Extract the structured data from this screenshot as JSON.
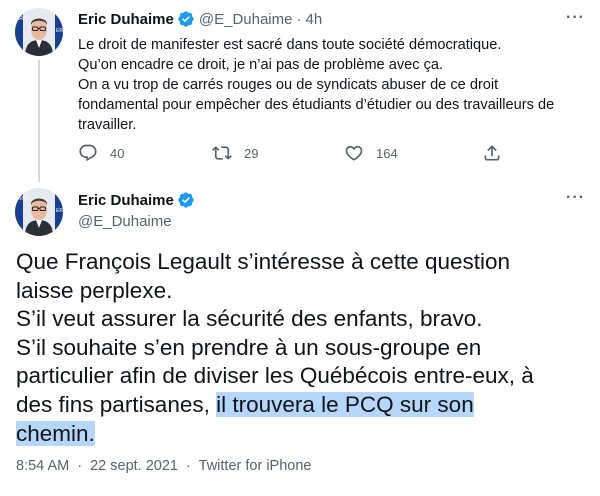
{
  "tweet1": {
    "author_name": "Eric Duhaime",
    "handle": "@E_Duhaime",
    "separator": "·",
    "time": "4h",
    "more": "···",
    "lines": [
      "Le droit de manifester est sacré dans toute société démocratique.",
      "Qu’on encadre ce droit, je n’ai pas de problème avec ça.",
      "On a vu trop de carrés rouges ou de syndicats abuser de ce droit",
      "fondamental pour empêcher des étudiants d’étudier ou des travailleurs de",
      "travailler."
    ],
    "replies": "40",
    "retweets": "29",
    "likes": "164"
  },
  "tweet2": {
    "author_name": "Eric Duhaime",
    "handle": "@E_Duhaime",
    "more": "···",
    "lines": [
      "Que François Legault s’intéresse à cette question",
      "laisse perplexe.",
      "S’il veut assurer la sécurité des enfants, bravo.",
      "S’il souhaite s’en prendre à un sous-groupe en",
      "particulier afin de diviser les Québécois entre-eux, à"
    ],
    "line6_plain": "des fins partisanes, ",
    "line6_highlight": "il trouvera le PCQ sur son",
    "line7_highlight": "chemin.",
    "time": "8:54 AM",
    "separator": "·",
    "date": "22 sept. 2021",
    "source": "Twitter for iPhone"
  },
  "avatar_badge": "ERIC",
  "icons": {
    "verified": "verified-badge-icon",
    "reply": "reply-icon",
    "retweet": "retweet-icon",
    "like": "heart-icon",
    "share": "share-icon"
  },
  "colors": {
    "verified": "#1d9bf0",
    "secondary_text": "#536471",
    "highlight": "#b6d6fb"
  }
}
